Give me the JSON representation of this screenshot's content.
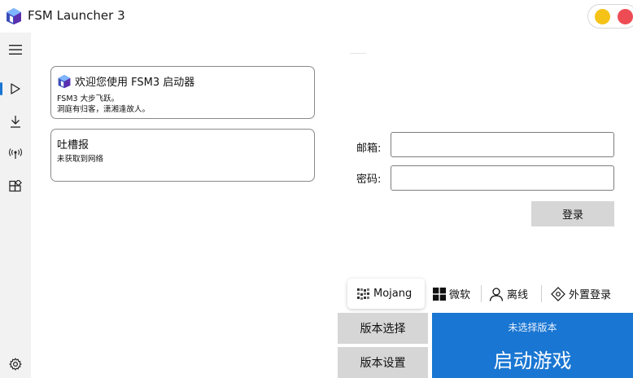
{
  "window": {
    "title": "FSM Launcher 3",
    "controls": {
      "minimize_color": "#f5c318",
      "close_color": "#ee4c55"
    }
  },
  "sidebar": {
    "items": [
      {
        "icon": "menu-icon"
      },
      {
        "icon": "play-icon",
        "active": true
      },
      {
        "icon": "download-icon"
      },
      {
        "icon": "broadcast-icon"
      },
      {
        "icon": "extensions-icon"
      },
      {
        "icon": "gear-icon"
      }
    ]
  },
  "cards": {
    "welcome": {
      "title": "欢迎您使用 FSM3 启动器",
      "lines": [
        "FSM3 大步飞跃。",
        "洞庭有归客，潇湘逢故人。"
      ]
    },
    "news": {
      "title": "吐槽报",
      "lines": [
        "未获取到网络"
      ]
    }
  },
  "login": {
    "email_label": "邮箱:",
    "email_value": "",
    "password_label": "密码:",
    "password_value": "",
    "submit_label": "登录"
  },
  "account_tabs": [
    {
      "label": "Mojang",
      "icon": "mojang-icon",
      "active": true
    },
    {
      "label": "微软",
      "icon": "windows-icon"
    },
    {
      "label": "离线",
      "icon": "user-icon"
    },
    {
      "label": "外置登录",
      "icon": "external-login-icon"
    }
  ],
  "bottom": {
    "version_select_label": "版本选择",
    "version_settings_label": "版本设置",
    "launch_status": "未选择版本",
    "launch_label": "启动游戏"
  },
  "colors": {
    "accent": "#1976d2",
    "sidebar_bg": "#f2f2f2",
    "button_gray": "#d6d6d6"
  }
}
